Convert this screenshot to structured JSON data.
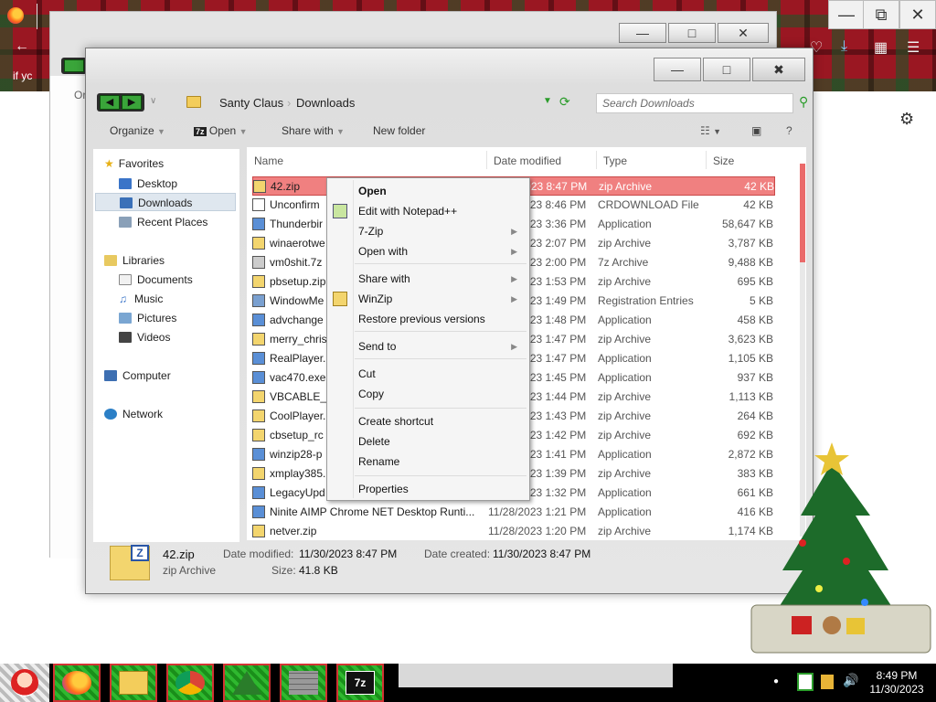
{
  "firefox": {
    "tab_title_fragment": "if yc",
    "page_fragment": "Or"
  },
  "ghost_window": {
    "caption_buttons": [
      "minimize",
      "maximize",
      "close"
    ]
  },
  "explorer": {
    "breadcrumb": [
      "Santy Claus",
      "Downloads"
    ],
    "search_placeholder": "Search Downloads",
    "toolbar": {
      "organize": "Organize",
      "open": "Open",
      "share_with": "Share with",
      "new_folder": "New folder"
    },
    "nav": {
      "favorites": "Favorites",
      "desktop": "Desktop",
      "downloads": "Downloads",
      "recent_places": "Recent Places",
      "libraries": "Libraries",
      "documents": "Documents",
      "music": "Music",
      "pictures": "Pictures",
      "videos": "Videos",
      "computer": "Computer",
      "network": "Network"
    },
    "columns": {
      "name": "Name",
      "date": "Date modified",
      "type": "Type",
      "size": "Size"
    },
    "files": [
      {
        "name": "42.zip",
        "date": "11/30/2023 8:47 PM",
        "type": "zip Archive",
        "size": "42 KB",
        "selected": true
      },
      {
        "name": "Unconfirm",
        "date": "11/30/2023 8:46 PM",
        "type": "CRDOWNLOAD File",
        "size": "42 KB"
      },
      {
        "name": "Thunderbir",
        "date": "11/30/2023 3:36 PM",
        "type": "Application",
        "size": "58,647 KB"
      },
      {
        "name": "winaerotwe",
        "date": "11/30/2023 2:07 PM",
        "type": "zip Archive",
        "size": "3,787 KB"
      },
      {
        "name": "vm0shit.7z",
        "date": "11/30/2023 2:00 PM",
        "type": "7z Archive",
        "size": "9,488 KB"
      },
      {
        "name": "pbsetup.zip",
        "date": "11/30/2023 1:53 PM",
        "type": "zip Archive",
        "size": "695 KB"
      },
      {
        "name": "WindowMe",
        "date": "11/30/2023 1:49 PM",
        "type": "Registration Entries",
        "size": "5 KB"
      },
      {
        "name": "advchange",
        "date": "11/30/2023 1:48 PM",
        "type": "Application",
        "size": "458 KB"
      },
      {
        "name": "merry_chris",
        "date": "11/30/2023 1:47 PM",
        "type": "zip Archive",
        "size": "3,623 KB"
      },
      {
        "name": "RealPlayer.",
        "date": "11/30/2023 1:47 PM",
        "type": "Application",
        "size": "1,105 KB"
      },
      {
        "name": "vac470.exe",
        "date": "11/30/2023 1:45 PM",
        "type": "Application",
        "size": "937 KB"
      },
      {
        "name": "VBCABLE_D",
        "date": "11/30/2023 1:44 PM",
        "type": "zip Archive",
        "size": "1,113 KB"
      },
      {
        "name": "CoolPlayer.",
        "date": "11/30/2023 1:43 PM",
        "type": "zip Archive",
        "size": "264 KB"
      },
      {
        "name": "cbsetup_rc",
        "date": "11/30/2023 1:42 PM",
        "type": "zip Archive",
        "size": "692 KB"
      },
      {
        "name": "winzip28-p",
        "date": "11/30/2023 1:41 PM",
        "type": "Application",
        "size": "2,872 KB"
      },
      {
        "name": "xmplay385.",
        "date": "11/30/2023 1:39 PM",
        "type": "zip Archive",
        "size": "383 KB"
      },
      {
        "name": "LegacyUpd",
        "date": "11/30/2023 1:32 PM",
        "type": "Application",
        "size": "661 KB"
      },
      {
        "name": "Ninite AIMP Chrome NET Desktop Runti...",
        "date": "11/28/2023 1:21 PM",
        "type": "Application",
        "size": "416 KB"
      },
      {
        "name": "netver.zip",
        "date": "11/28/2023 1:20 PM",
        "type": "zip Archive",
        "size": "1,174 KB"
      }
    ],
    "details": {
      "filename": "42.zip",
      "filetype": "zip Archive",
      "date_modified_label": "Date modified:",
      "date_modified": "11/30/2023 8:47 PM",
      "date_created_label": "Date created:",
      "date_created": "11/30/2023 8:47 PM",
      "size_label": "Size:",
      "size": "41.8 KB"
    }
  },
  "context_menu": {
    "open": "Open",
    "edit_notepad": "Edit with Notepad++",
    "sevenzip": "7-Zip",
    "open_with": "Open with",
    "share_with": "Share with",
    "winzip": "WinZip",
    "restore": "Restore previous versions",
    "send_to": "Send to",
    "cut": "Cut",
    "copy": "Copy",
    "create_shortcut": "Create shortcut",
    "delete": "Delete",
    "rename": "Rename",
    "properties": "Properties"
  },
  "taskbar": {
    "apps": [
      "santa-start",
      "firefox",
      "file-explorer",
      "chrome",
      "christmas-tree",
      "brick-wall",
      "7zip"
    ],
    "time": "8:49 PM",
    "date": "11/30/2023"
  },
  "colors": {
    "selection": "#f08080",
    "tartan_red": "#9a1722",
    "taskbar_green": "#2fb82f"
  }
}
